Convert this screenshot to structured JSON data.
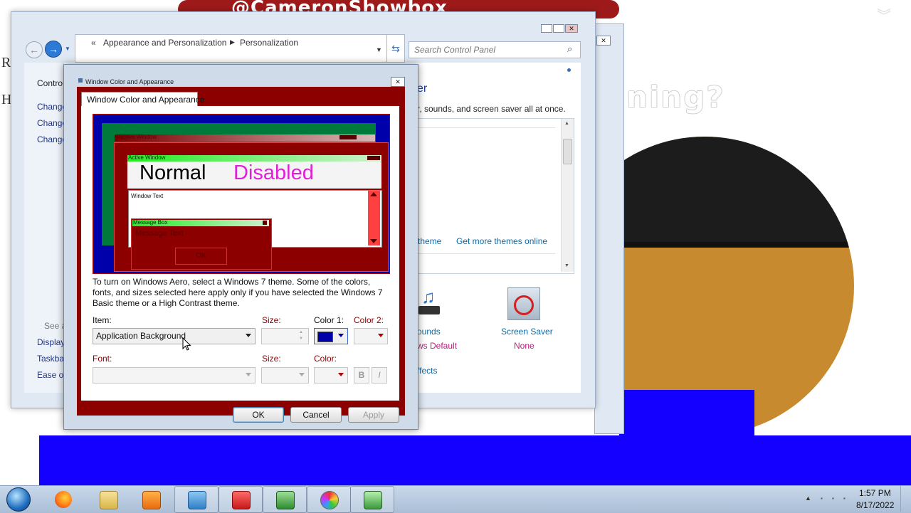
{
  "wallpaper": {
    "banner_text": "@CameronShowbox",
    "big_text_visible": "ning?",
    "left_letters": [
      "R",
      "H"
    ]
  },
  "cp_window": {
    "breadcrumb": [
      "Appearance and Personalization",
      "Personalization"
    ],
    "search_placeholder": "Search Control Panel",
    "sidebar_home": "Contro",
    "sidebar_links": [
      "Change",
      "Change",
      "Change"
    ],
    "see_also_label": "See a",
    "see_also_links": [
      "Display",
      "Taskba",
      "Ease of"
    ],
    "heading_partial": "er",
    "description_partial": "r, sounds, and screen saver all at once.",
    "theme_links": [
      "theme",
      "Get more themes online"
    ],
    "sounds": {
      "label": "ounds",
      "value": "ws Default"
    },
    "screen_saver": {
      "label": "Screen Saver",
      "value": "None"
    },
    "effects_partial": "ffects"
  },
  "dialog": {
    "title": "Window Color and Appearance",
    "tab_label": "Window Color and Appearance",
    "preview": {
      "inactive_title": "Inactive Window",
      "active_title": "Active Window",
      "normal": "Normal",
      "disabled": "Disabled",
      "window_text": "Window Text",
      "message_box_title": "Message Box",
      "message_text": "Message Text",
      "ok": "OK"
    },
    "info": "To turn on Windows Aero, select a Windows 7 theme.  Some of the colors, fonts, and sizes selected here apply only if you have selected the Windows 7 Basic theme or a High Contrast theme.",
    "item_label": "Item:",
    "item_value": "Application Background",
    "size_label": "Size:",
    "color1_label": "Color 1:",
    "color2_label": "Color 2:",
    "font_label": "Font:",
    "font_size_label": "Size:",
    "font_color_label": "Color:",
    "bold": "B",
    "italic": "I",
    "ok": "OK",
    "cancel": "Cancel",
    "apply": "Apply",
    "colors": {
      "panel": "#8c0000",
      "preview_desktop": "#0000aa",
      "inactive_window": "#007a3a",
      "disabled_text": "#e020d8",
      "color1_swatch": "#0000aa"
    }
  },
  "taskbar": {
    "apps": [
      "firefox-icon",
      "explorer-icon",
      "media-player-icon",
      "control-panel-icon",
      "toolbox-icon",
      "task-manager-icon",
      "paint-icon",
      "display-settings-icon"
    ],
    "time": "1:57 PM",
    "date": "8/17/2022"
  }
}
